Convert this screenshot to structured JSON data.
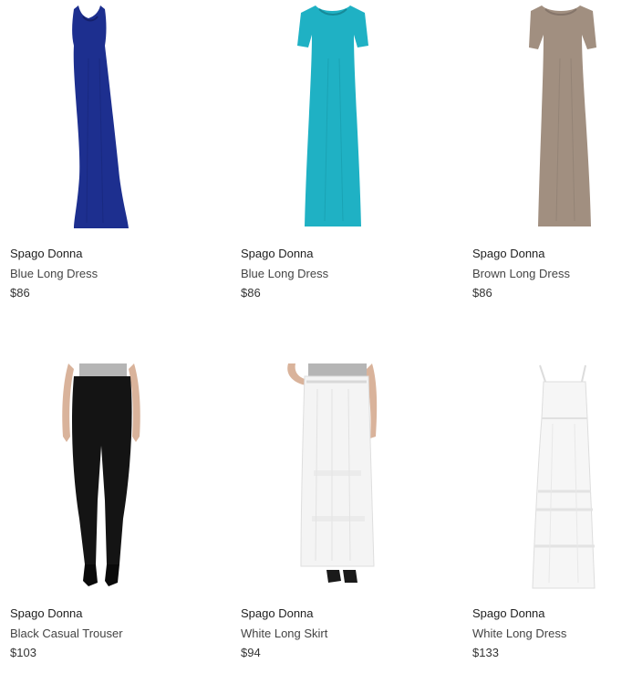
{
  "colors": {
    "background": "#ffffff",
    "blue_dress": "#1d2f8f",
    "teal_dress": "#1fb1c4",
    "brown_dress": "#a18f80",
    "black_trouser": "#141414",
    "white_skirt": "#f4f4f4",
    "white_dress": "#f6f6f6",
    "grey_top": "#b5b5b5",
    "skin": "#d9b39b"
  },
  "products": [
    {
      "brand": "Spago Donna",
      "name": "Blue Long Dress",
      "price": "$86",
      "image_icon": "sleeveless-maxi-dress-icon"
    },
    {
      "brand": "Spago Donna",
      "name": "Blue Long Dress",
      "price": "$86",
      "image_icon": "short-sleeve-maxi-dress-icon"
    },
    {
      "brand": "Spago Donna",
      "name": "Brown Long Dress",
      "price": "$86",
      "image_icon": "short-sleeve-maxi-dress-icon"
    },
    {
      "brand": "Spago Donna",
      "name": "Black Casual Trouser",
      "price": "$103",
      "image_icon": "trouser-icon"
    },
    {
      "brand": "Spago Donna",
      "name": "White Long Skirt",
      "price": "$94",
      "image_icon": "maxi-skirt-icon"
    },
    {
      "brand": "Spago Donna",
      "name": "White Long Dress",
      "price": "$133",
      "image_icon": "strappy-maxi-dress-icon"
    }
  ]
}
